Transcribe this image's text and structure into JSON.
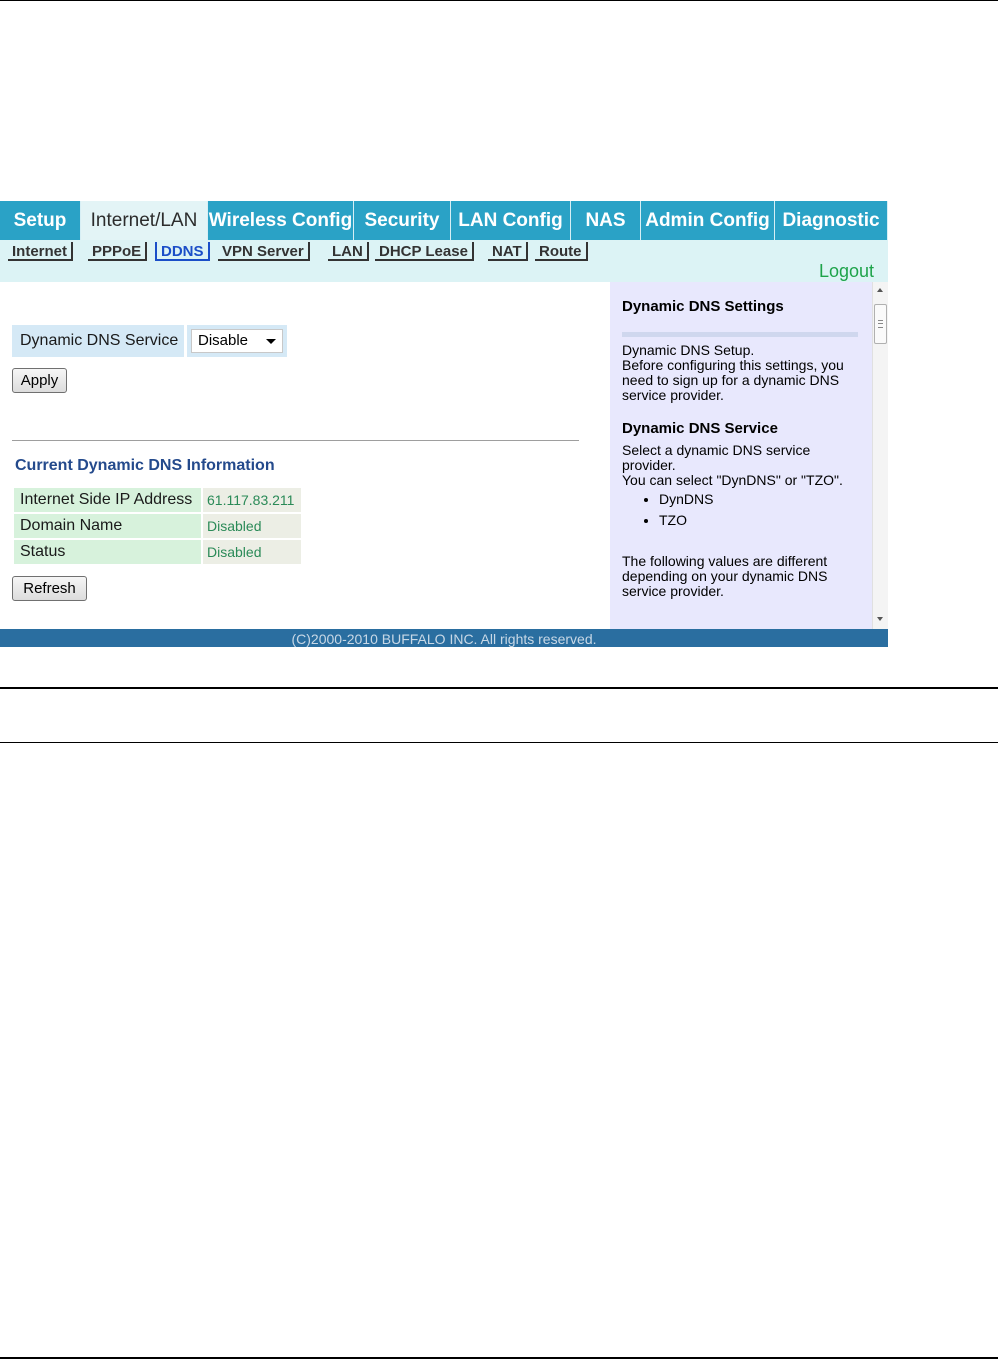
{
  "main_nav": {
    "tabs": [
      {
        "label": "Setup"
      },
      {
        "label": "Internet/LAN"
      },
      {
        "label": "Wireless Config"
      },
      {
        "label": "Security"
      },
      {
        "label": "LAN Config"
      },
      {
        "label": "NAS"
      },
      {
        "label": "Admin Config"
      },
      {
        "label": "Diagnostic"
      }
    ],
    "active": "Internet/LAN"
  },
  "sub_nav": {
    "tabs": [
      {
        "label": "Internet"
      },
      {
        "label": "PPPoE"
      },
      {
        "label": "DDNS"
      },
      {
        "label": "VPN Server"
      },
      {
        "label": "LAN"
      },
      {
        "label": "DHCP Lease"
      },
      {
        "label": "NAT"
      },
      {
        "label": "Route"
      }
    ],
    "active": "DDNS",
    "logout_label": "Logout"
  },
  "ddns_form": {
    "label": "Dynamic DNS Service",
    "selected": "Disable",
    "apply_label": "Apply"
  },
  "current_info": {
    "title": "Current Dynamic DNS Information",
    "rows": [
      {
        "label": "Internet Side IP Address",
        "value": "61.117.83.211"
      },
      {
        "label": "Domain Name",
        "value": "Disabled"
      },
      {
        "label": "Status",
        "value": "Disabled"
      }
    ],
    "refresh_label": "Refresh"
  },
  "help": {
    "title": "Dynamic DNS Settings",
    "intro_line1": "Dynamic DNS Setup.",
    "intro_line2": "Before configuring this settings, you need to sign up for a dynamic DNS service provider.",
    "service_title": "Dynamic DNS Service",
    "service_text1": "Select a dynamic DNS service provider.",
    "service_text2": "You can select \"DynDNS\" or \"TZO\".",
    "providers": [
      "DynDNS",
      "TZO"
    ],
    "following_text": "The following values are different depending on your dynamic DNS service provider."
  },
  "footer": {
    "copyright": "(C)2000-2010 BUFFALO INC. All rights reserved."
  }
}
